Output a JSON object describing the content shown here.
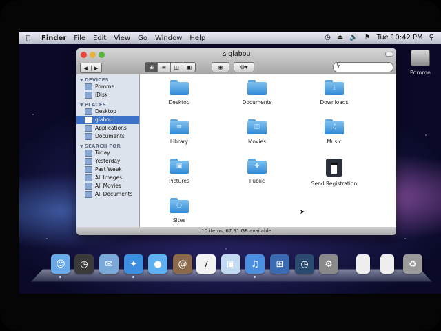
{
  "menubar": {
    "apple": "",
    "items": [
      "Finder",
      "File",
      "Edit",
      "View",
      "Go",
      "Window",
      "Help"
    ],
    "clock": "Tue 10:42 PM"
  },
  "desktop": {
    "drive_label": "Pomme"
  },
  "window": {
    "title": "glabou",
    "search_placeholder": "",
    "status": "10 items, 67.31 GB available"
  },
  "sidebar": {
    "devices_header": "DEVICES",
    "devices": [
      "Pomme",
      "iDisk"
    ],
    "places_header": "PLACES",
    "places": [
      "Desktop",
      "glabou",
      "Applications",
      "Documents"
    ],
    "search_header": "SEARCH FOR",
    "searches": [
      "Today",
      "Yesterday",
      "Past Week",
      "All Images",
      "All Movies",
      "All Documents"
    ]
  },
  "items": [
    {
      "label": "Desktop",
      "icon": "folder-icon"
    },
    {
      "label": "Documents",
      "icon": "folder-icon"
    },
    {
      "label": "Downloads",
      "icon": "downloads-folder-icon"
    },
    {
      "label": "Library",
      "icon": "library-folder-icon"
    },
    {
      "label": "Movies",
      "icon": "movies-folder-icon"
    },
    {
      "label": "Music",
      "icon": "music-folder-icon"
    },
    {
      "label": "Pictures",
      "icon": "pictures-folder-icon"
    },
    {
      "label": "Public",
      "icon": "public-folder-icon"
    },
    {
      "label": "Send Registration",
      "icon": "tuxedo-icon"
    },
    {
      "label": "Sites",
      "icon": "sites-folder-icon"
    }
  ],
  "dock": [
    "finder",
    "dashboard",
    "mail",
    "safari",
    "ichat",
    "address-book",
    "ical",
    "preview",
    "itunes",
    "spaces",
    "time-machine",
    "system-preferences",
    "document",
    "document",
    "trash"
  ],
  "dock_calendar_day": "7",
  "colors": {
    "selection": "#3c72c8",
    "folder": "#3d95dc"
  }
}
